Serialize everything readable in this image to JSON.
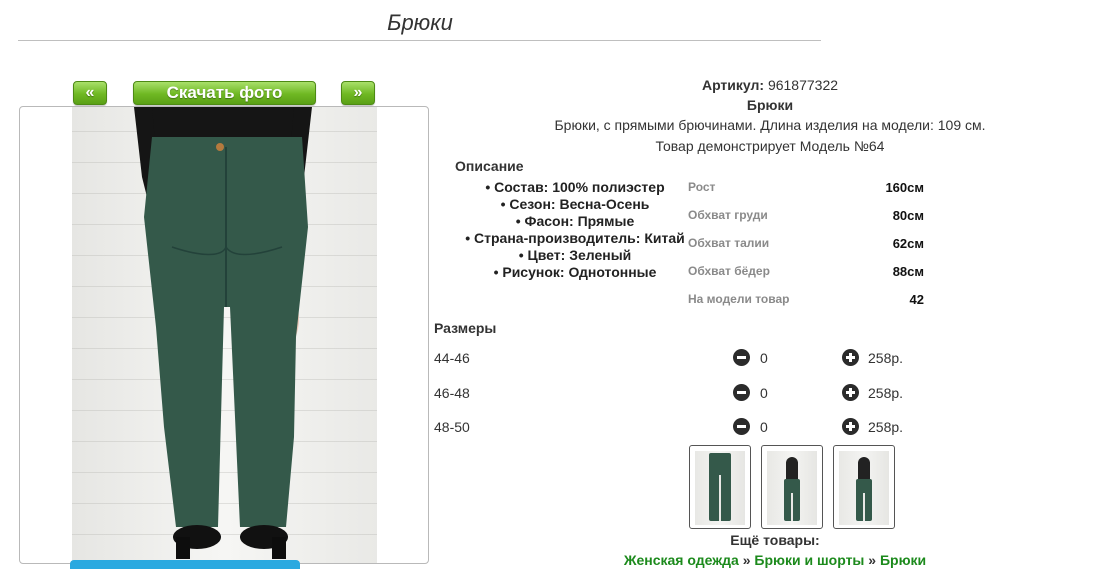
{
  "page": {
    "title": "Брюки"
  },
  "gallery": {
    "prev_label": "«",
    "next_label": "»",
    "download_label": "Скачать фото"
  },
  "product": {
    "article_label": "Артикул:",
    "article_value": "961877322",
    "name": "Брюки",
    "summary": "Брюки, с прямыми брючинами. Длина изделия на модели: 109 см.",
    "model_note": "Товар демонстрирует Модель №64"
  },
  "description": {
    "title": "Описание",
    "items": [
      "Состав: 100% полиэстер",
      "Сезон: Весна-Осень",
      "Фасон: Прямые",
      "Страна-производитель: Китай",
      "Цвет: Зеленый",
      "Рисунок: Однотонные"
    ]
  },
  "measurements": [
    {
      "label": "Рост",
      "value": "160см"
    },
    {
      "label": "Обхват груди",
      "value": "80см"
    },
    {
      "label": "Обхват талии",
      "value": "62см"
    },
    {
      "label": "Обхват бёдер",
      "value": "88см"
    },
    {
      "label": "На модели товар",
      "value": "42"
    }
  ],
  "sizes": {
    "title": "Размеры",
    "rows": [
      {
        "size": "44-46",
        "qty": "0",
        "price": "258р."
      },
      {
        "size": "46-48",
        "qty": "0",
        "price": "258р."
      },
      {
        "size": "48-50",
        "qty": "0",
        "price": "258р."
      }
    ]
  },
  "more": {
    "title": "Ещё товары:",
    "crumbs": [
      "Женская одежда",
      "Брюки и шорты",
      "Брюки"
    ],
    "separator": "»"
  },
  "colors": {
    "green_button": "#6fb823",
    "link": "#1c8a1c",
    "pants": "#34594a",
    "blue_bar": "#2aa9e0"
  }
}
